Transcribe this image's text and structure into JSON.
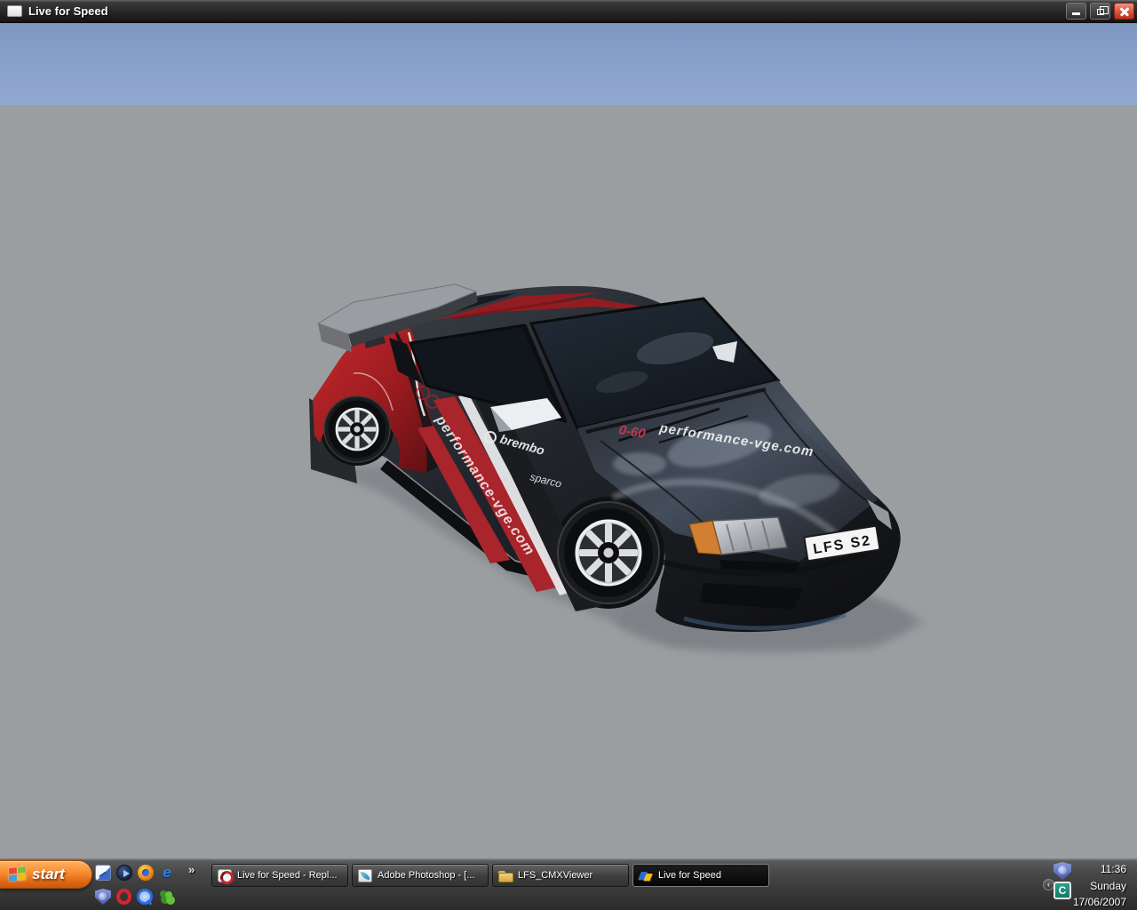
{
  "window": {
    "title": "Live for Speed",
    "controls": {
      "minimize": "minimize",
      "restore": "restore",
      "close": "close"
    }
  },
  "scene": {
    "sky_color_top": "#7e97c2",
    "sky_color_bottom": "#93a9d0",
    "ground_color": "#9b9ea1",
    "car": {
      "license_plate": "LFS S2",
      "decals": {
        "brembo": "brembo",
        "sparco": "sparco",
        "side_graffiti": "performance-vge.com",
        "hood_graffiti_red": "0-60",
        "hood_graffiti_white": "performance-vge.com"
      },
      "body_colors": {
        "primary_dark": "#23262b",
        "accent_red": "#a8232a",
        "carbon_hood": "#3a4250",
        "spoiler_gray": "#9a9da2"
      }
    }
  },
  "taskbar": {
    "start": {
      "label": "start",
      "icon": "windows-flag-icon"
    },
    "overflow_chevron": "»",
    "quick_launch_row1": [
      "show-desktop-icon",
      "media-player-icon",
      "firefox-icon",
      "internet-explorer-icon"
    ],
    "quick_launch_row2": [
      "security-shield-icon",
      "opera-icon",
      "quicktime-icon",
      "messenger-icon"
    ],
    "buttons": [
      {
        "label": "Live for Speed - Repl...",
        "icon": "lfs-replay-icon",
        "active": false
      },
      {
        "label": "Adobe Photoshop - [...",
        "icon": "photoshop-icon",
        "active": false
      },
      {
        "label": "LFS_CMXViewer",
        "icon": "folder-icon",
        "active": false
      },
      {
        "label": "Live for Speed",
        "icon": "lfs-icon",
        "active": true
      }
    ],
    "tray": {
      "collapse_chevron": "‹",
      "icons": [
        "security-shield-icon",
        "codec-icon"
      ],
      "time": "11:36",
      "day": "Sunday",
      "date": "17/06/2007"
    }
  }
}
